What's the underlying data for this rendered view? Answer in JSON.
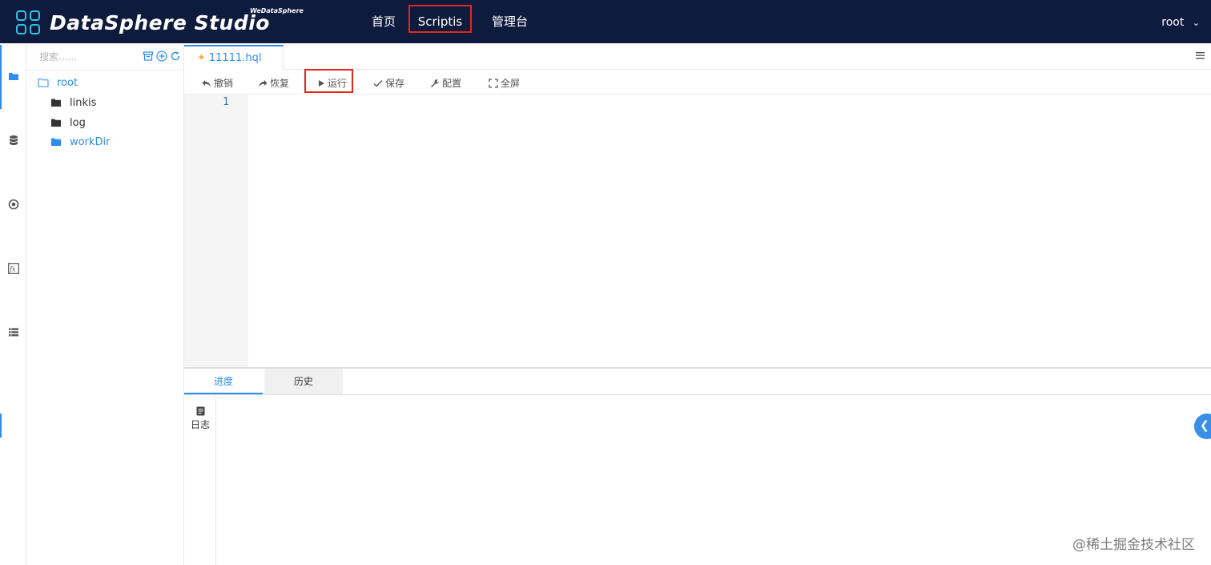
{
  "header": {
    "brand": "DataSphere Studio",
    "brand_sub": "WeDataSphere",
    "nav": [
      {
        "label": "首页"
      },
      {
        "label": "Scriptis"
      },
      {
        "label": "管理台"
      }
    ],
    "user": "root",
    "colors": {
      "bg": "#0f1b3d",
      "accent": "#2bc3e8",
      "highlight": "#e0281e"
    }
  },
  "rail": {
    "icons": [
      "folder-icon",
      "database-icon",
      "target-icon",
      "function-icon",
      "table-icon"
    ]
  },
  "sidebar": {
    "search_placeholder": "搜索......",
    "tools": [
      "archive-icon",
      "add-circle-icon",
      "refresh-icon"
    ],
    "tree": [
      {
        "label": "root",
        "icon": "folder-outline-icon"
      },
      {
        "label": "linkis",
        "icon": "folder-icon"
      },
      {
        "label": "log",
        "icon": "folder-icon"
      },
      {
        "label": "workDir",
        "icon": "folder-icon"
      }
    ]
  },
  "editor": {
    "tab_label": "11111.hql",
    "toolbar": {
      "undo": "撤销",
      "redo": "恢复",
      "run": "运行",
      "save": "保存",
      "config": "配置",
      "fullscreen": "全屏"
    },
    "line_numbers": [
      "1"
    ]
  },
  "bottom": {
    "tabs": [
      {
        "label": "进度"
      },
      {
        "label": "历史"
      }
    ],
    "log_label": "日志"
  },
  "watermark": "@稀土掘金技术社区"
}
